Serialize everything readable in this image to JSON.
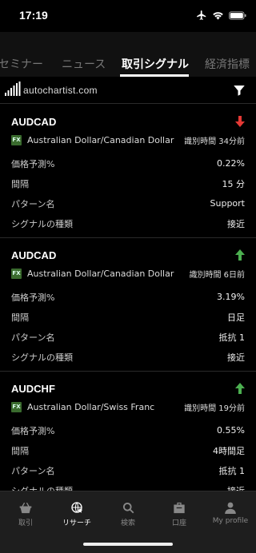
{
  "status": {
    "time": "17:19"
  },
  "tabs": [
    {
      "label": "セミナー",
      "active": false
    },
    {
      "label": "ニュース",
      "active": false
    },
    {
      "label": "取引シグナル",
      "active": true
    },
    {
      "label": "経済指標",
      "active": false
    }
  ],
  "brand": {
    "name": "autochartist.com"
  },
  "signals": [
    {
      "symbol": "AUDCAD",
      "direction": "down",
      "badge": "FX",
      "pair_name": "Australian Dollar/Canadian Dollar",
      "ident_time": "識別時間 34分前",
      "rows": [
        {
          "key": "価格予測%",
          "value": "0.22%"
        },
        {
          "key": "間隔",
          "value": "15 分"
        },
        {
          "key": "パターン名",
          "value": "Support"
        },
        {
          "key": "シグナルの種類",
          "value": "接近"
        }
      ]
    },
    {
      "symbol": "AUDCAD",
      "direction": "up",
      "badge": "FX",
      "pair_name": "Australian Dollar/Canadian Dollar",
      "ident_time": "識別時間 6日前",
      "rows": [
        {
          "key": "価格予測%",
          "value": "3.19%"
        },
        {
          "key": "間隔",
          "value": "日足"
        },
        {
          "key": "パターン名",
          "value": "抵抗 1"
        },
        {
          "key": "シグナルの種類",
          "value": "接近"
        }
      ]
    },
    {
      "symbol": "AUDCHF",
      "direction": "up",
      "badge": "FX",
      "pair_name": "Australian Dollar/Swiss Franc",
      "ident_time": "識別時間 19分前",
      "rows": [
        {
          "key": "価格予測%",
          "value": "0.55%"
        },
        {
          "key": "間隔",
          "value": "4時間足"
        },
        {
          "key": "パターン名",
          "value": "抵抗 1"
        },
        {
          "key": "シグナルの種類",
          "value": "接近"
        }
      ]
    }
  ],
  "tabbar": [
    {
      "label": "取引",
      "icon": "basket-icon",
      "active": false
    },
    {
      "label": "リサーチ",
      "icon": "globe-star-icon",
      "active": true
    },
    {
      "label": "検索",
      "icon": "search-icon",
      "active": false
    },
    {
      "label": "口座",
      "icon": "briefcase-icon",
      "active": false
    },
    {
      "label": "My profile",
      "icon": "person-icon",
      "active": false
    }
  ],
  "colors": {
    "up": "#4caf50",
    "down": "#e53935",
    "fx_badge": "#3a6b2e"
  }
}
